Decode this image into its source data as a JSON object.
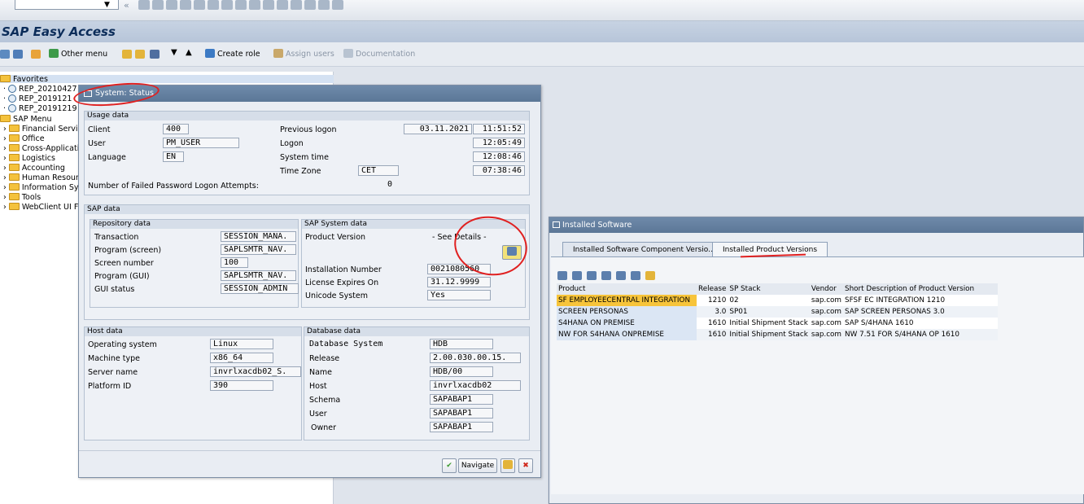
{
  "toolbar": {
    "nav_back_label": "«"
  },
  "title": "SAP Easy Access",
  "appbar": {
    "other_menu": "Other menu",
    "create_role": "Create role",
    "assign_users": "Assign users",
    "documentation": "Documentation"
  },
  "tree": {
    "favorites": "Favorites",
    "fav_items": [
      "REP_20210427",
      "REP_2019121",
      "REP_20191219"
    ],
    "sap_menu": "SAP Menu",
    "menu_items": [
      "Financial Servic",
      "Office",
      "Cross-Applicati",
      "Logistics",
      "Accounting",
      "Human Resourc",
      "Information Sy",
      "Tools",
      "WebClient UI F"
    ]
  },
  "status": {
    "title": "System: Status",
    "usage": {
      "header": "Usage data",
      "client_label": "Client",
      "client": "400",
      "user_label": "User",
      "user": "PM_USER",
      "language_label": "Language",
      "language": "EN",
      "prev_logon_label": "Previous logon",
      "prev_logon_date": "03.11.2021",
      "prev_logon_time": "11:51:52",
      "logon_label": "Logon",
      "logon_time": "12:05:49",
      "system_time_label": "System time",
      "system_time": "12:08:46",
      "tz_label": "Time Zone",
      "tz": "CET",
      "tz_time": "07:38:46",
      "failed_label": "Number of Failed Password Logon Attempts:",
      "failed": "0"
    },
    "sap": {
      "header": "SAP data",
      "repo_header": "Repository data",
      "transaction_label": "Transaction",
      "transaction": "SESSION_MANA.",
      "program_screen_label": "Program (screen)",
      "program_screen": "SAPLSMTR_NAV.",
      "screen_no_label": "Screen number",
      "screen_no": "100",
      "program_gui_label": "Program (GUI)",
      "program_gui": "SAPLSMTR_NAV.",
      "gui_status_label": "GUI status",
      "gui_status": "SESSION_ADMIN",
      "sys_header": "SAP System data",
      "product_version_label": "Product Version",
      "product_version": "- See Details -",
      "install_no_label": "Installation Number",
      "install_no": "0021080560",
      "license_label": "License Expires On",
      "license": "31.12.9999",
      "unicode_label": "Unicode System",
      "unicode": "Yes"
    },
    "host": {
      "header": "Host data",
      "os_label": "Operating system",
      "os": "Linux",
      "machine_label": "Machine type",
      "machine": "x86_64",
      "server_label": "Server name",
      "server": "invrlxacdb02_S.",
      "platform_label": "Platform ID",
      "platform": "390"
    },
    "db": {
      "header": "Database data",
      "system_label": "Database System",
      "system": "HDB",
      "release_label": "Release",
      "release": "2.00.030.00.15.",
      "name_label": "Name",
      "name": "HDB/00",
      "host_label": "Host",
      "host": "invrlxacdb02",
      "schema_label": "Schema",
      "schema": "SAPABAP1",
      "user_label": "User",
      "user": "SAPABAP1",
      "owner_label": "Owner",
      "owner": "SAPABAP1"
    },
    "navigate_label": "Navigate"
  },
  "installed": {
    "title": "Installed Software",
    "tab1": "Installed Software Component Versio...",
    "tab2": "Installed Product Versions",
    "columns": [
      "Product",
      "Release",
      "SP Stack",
      "Vendor",
      "Short Description of Product Version"
    ],
    "rows": [
      [
        "SF EMPLOYEECENTRAL INTEGRATION",
        "1210",
        "02",
        "sap.com",
        "SFSF EC INTEGRATION 1210"
      ],
      [
        "SCREEN PERSONAS",
        "3.0",
        "SP01",
        "sap.com",
        "SAP SCREEN PERSONAS 3.0"
      ],
      [
        "S4HANA ON PREMISE",
        "1610",
        "Initial Shipment Stack",
        "sap.com",
        "SAP S/4HANA 1610"
      ],
      [
        "NW FOR S4HANA ONPREMISE",
        "1610",
        "Initial Shipment Stack",
        "sap.com",
        "NW 7.51 FOR S/4HANA OP 1610"
      ]
    ]
  },
  "colors": {
    "accent": "#0b2c59",
    "highlight": "#f7c43a",
    "annotation": "#e02020"
  }
}
